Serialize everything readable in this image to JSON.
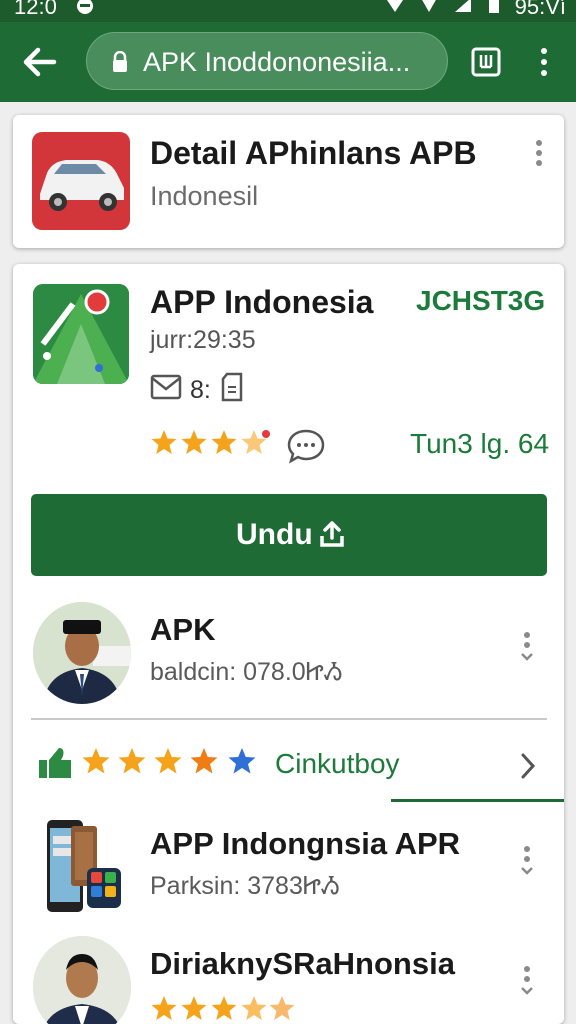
{
  "status_bar": {
    "time": "12:0",
    "battery": "95:Ví"
  },
  "toolbar": {
    "url": "APK Inoddononesiia..."
  },
  "card_top": {
    "title": "Detail APhinlans APB",
    "subtitle": "Indonesil"
  },
  "app": {
    "name": "APP Indonesia",
    "developer": "JCHST3G",
    "version": "jurr:29:35",
    "mail_count": "8:",
    "rating_stars": 3.5,
    "size": "Tun3 lg. 64",
    "download_label": "Undu"
  },
  "list": [
    {
      "title": "APK",
      "subtitle": "baldcin: 078.0ᏥᏱ"
    },
    {
      "title": "APP Indongnsia APR",
      "subtitle": "Parksin: 3783ᏥᏱ"
    },
    {
      "title": "DiriaknySRaHnonsia"
    }
  ],
  "recommend": {
    "label": "Cinkutboy",
    "stars": 5
  },
  "colors": {
    "primary": "#1f6b36",
    "accent_text": "#1c7a3a",
    "star": "#f6a31c",
    "star_blue": "#2f6fd6"
  }
}
